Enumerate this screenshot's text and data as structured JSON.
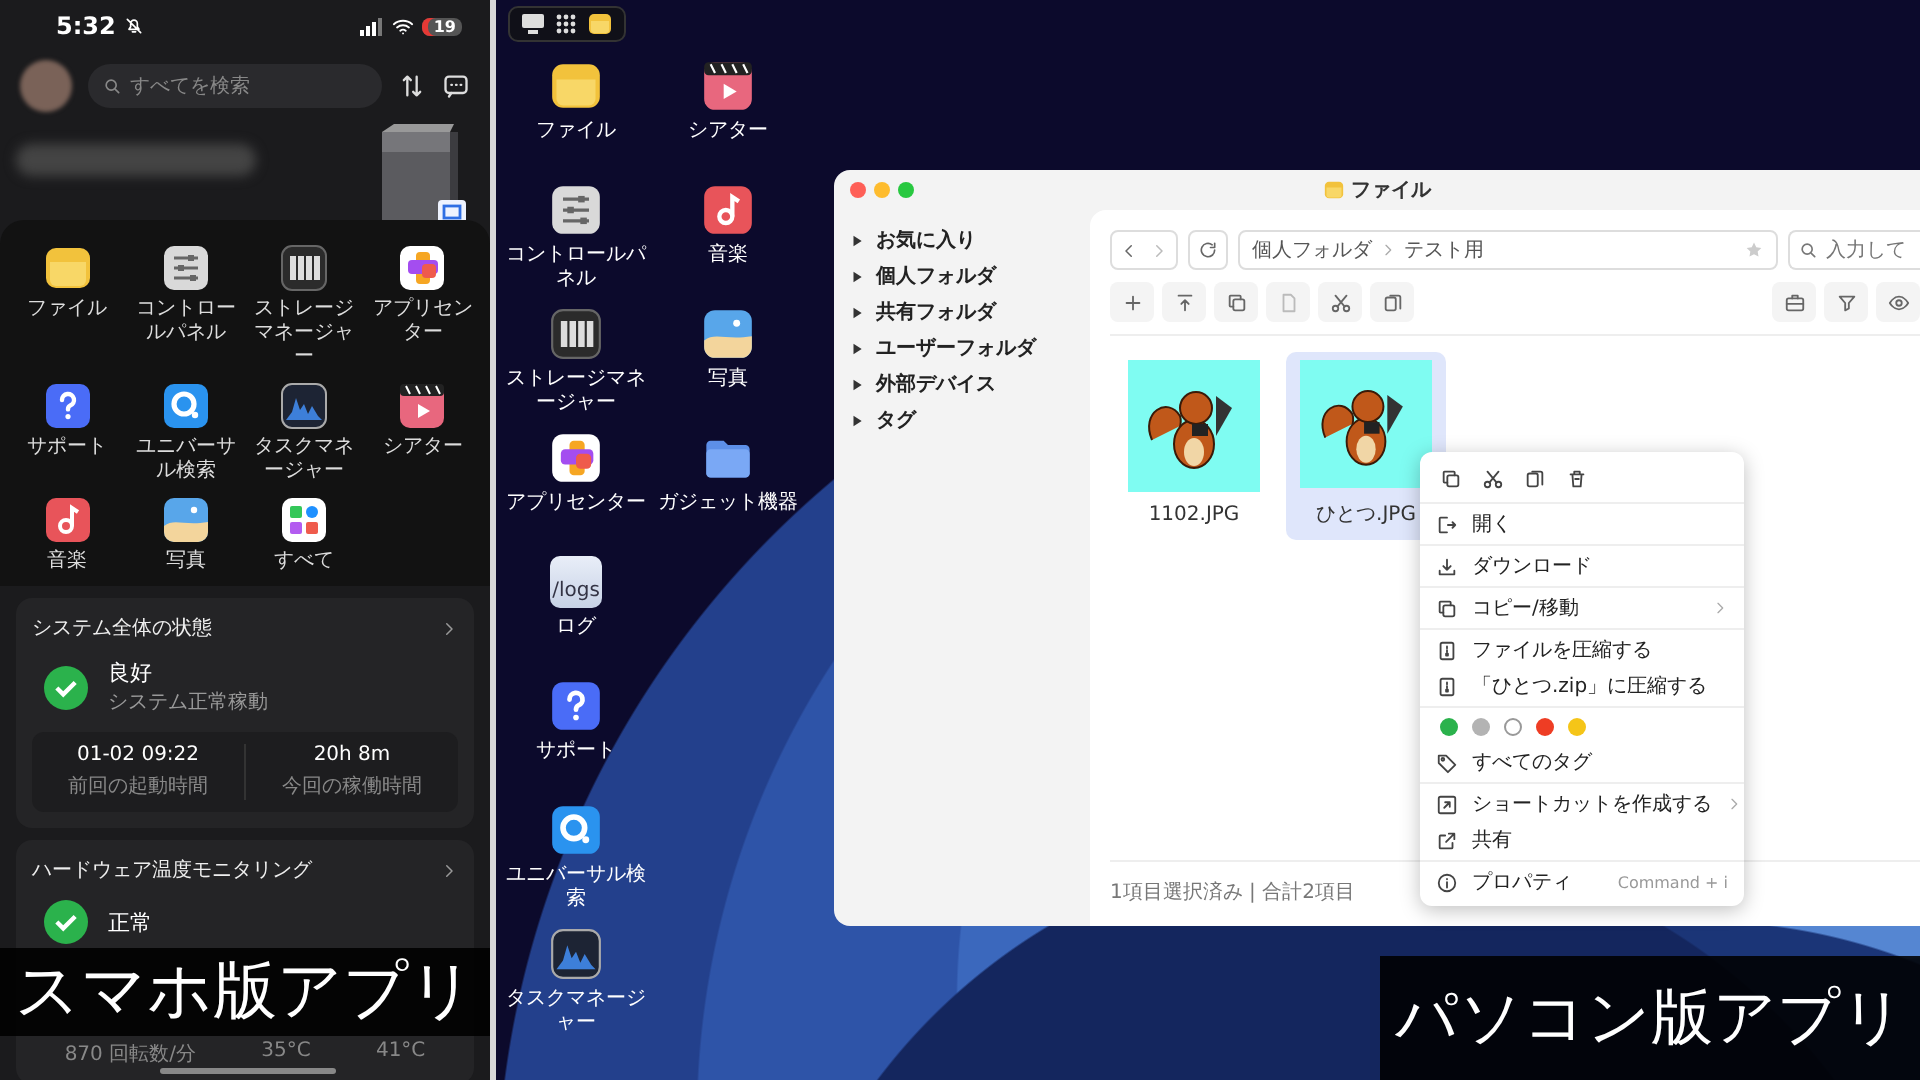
{
  "phone": {
    "status_bar": {
      "time": "5:32",
      "battery": "19"
    },
    "search": {
      "placeholder": "すべてを検索"
    },
    "apps": [
      {
        "label": "ファイル",
        "kind": "files"
      },
      {
        "label": "コントロールパネル",
        "kind": "control"
      },
      {
        "label": "ストレージマネージャー",
        "kind": "storage"
      },
      {
        "label": "アプリセンター",
        "kind": "appcenter"
      },
      {
        "label": "サポート",
        "kind": "support"
      },
      {
        "label": "ユニバーサル検索",
        "kind": "search"
      },
      {
        "label": "タスクマネージャー",
        "kind": "taskmgr"
      },
      {
        "label": "シアター",
        "kind": "theater"
      },
      {
        "label": "音楽",
        "kind": "music"
      },
      {
        "label": "写真",
        "kind": "photos"
      },
      {
        "label": "すべて",
        "kind": "all"
      }
    ],
    "system_status": {
      "title": "システム全体の状態",
      "status": "良好",
      "detail": "システム正常稼動",
      "stats": [
        {
          "value": "01-02 09:22",
          "label": "前回の起動時間"
        },
        {
          "value": "20h 8m",
          "label": "今回の稼働時間"
        }
      ]
    },
    "hardware_monitor": {
      "title": "ハードウェア温度モニタリング",
      "status": "正常",
      "readings": [
        "870 回転数/分",
        "35°C",
        "41°C"
      ]
    },
    "caption": "スマホ版アプリ"
  },
  "desktop": {
    "icons": [
      {
        "label": "ファイル",
        "kind": "files"
      },
      {
        "label": "コントロールパネル",
        "kind": "control"
      },
      {
        "label": "ストレージマネージャー",
        "kind": "storage"
      },
      {
        "label": "アプリセンター",
        "kind": "appcenter"
      },
      {
        "label": "ログ",
        "kind": "logs",
        "icon_text": "/logs"
      },
      {
        "label": "サポート",
        "kind": "support"
      },
      {
        "label": "ユニバーサル検索",
        "kind": "search"
      },
      {
        "label": "タスクマネージャー",
        "kind": "taskmgr"
      },
      {
        "label": "シアター",
        "kind": "theater"
      },
      {
        "label": "音楽",
        "kind": "music"
      },
      {
        "label": "写真",
        "kind": "photos"
      },
      {
        "label": "ガジェット機器",
        "kind": "gadget"
      }
    ],
    "caption": "パソコン版アプリ"
  },
  "file_window": {
    "title": "ファイル",
    "sidebar": [
      {
        "label": "お気に入り",
        "expanded": false
      },
      {
        "label": "個人フォルダ",
        "expanded": false
      },
      {
        "label": "共有フォルダ",
        "expanded": false
      },
      {
        "label": "ユーザーフォルダ",
        "expanded": false
      },
      {
        "label": "外部デバイス",
        "expanded": false
      },
      {
        "label": "タグ",
        "expanded": false
      }
    ],
    "path": [
      "個人フォルダ",
      "テスト用"
    ],
    "search": {
      "placeholder": "入力して"
    },
    "files": [
      {
        "name": "1102.JPG",
        "selected": false
      },
      {
        "name": "ひとつ.JPG",
        "selected": true
      }
    ],
    "status": "1項目選択済み | 合計2項目",
    "context_menu": {
      "groups": [
        [
          {
            "kind": "action",
            "label": "開く",
            "submenu": false
          }
        ],
        [
          {
            "kind": "action",
            "label": "ダウンロード",
            "submenu": false
          }
        ],
        [
          {
            "kind": "action",
            "label": "コピー/移動",
            "submenu": true
          }
        ],
        [
          {
            "kind": "action",
            "label": "ファイルを圧縮する",
            "submenu": false
          },
          {
            "kind": "action",
            "label": "「ひとつ.zip」に圧縮する",
            "submenu": false
          }
        ],
        [
          {
            "kind": "colors",
            "colors": [
              {
                "color": "#2bb24c"
              },
              {
                "color": "#b3b3b3"
              },
              {
                "color": "#ffffff"
              },
              {
                "color": "#ee3d24"
              },
              {
                "color": "#f5c518"
              }
            ]
          },
          {
            "kind": "action",
            "label": "すべてのタグ",
            "submenu": false
          }
        ],
        [
          {
            "kind": "action",
            "label": "ショートカットを作成する",
            "submenu": true
          },
          {
            "kind": "action",
            "label": "共有",
            "submenu": false
          }
        ],
        [
          {
            "kind": "action",
            "label": "プロパティ",
            "submenu": false,
            "shortcut": "Command + i"
          }
        ]
      ]
    }
  }
}
